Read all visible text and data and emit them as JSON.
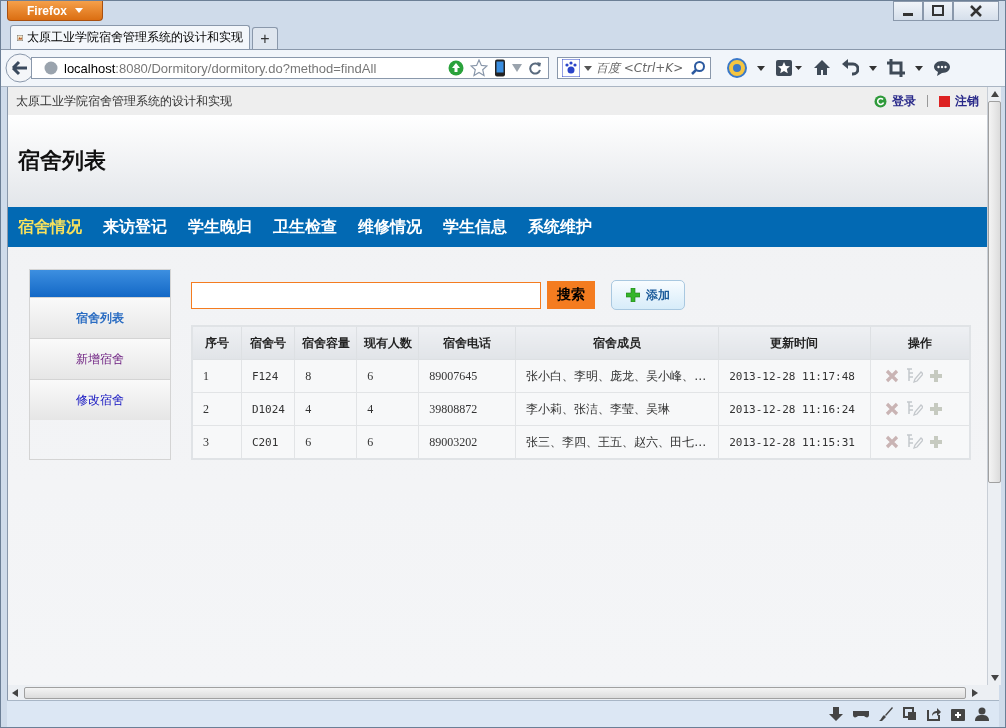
{
  "browser": {
    "menu_button": "Firefox",
    "tab_title": "太原工业学院宿舍管理系统的设计和实现",
    "new_tab": "+",
    "url_host": "localhost",
    "url_rest": ":8080/Dormitory/dormitory.do?method=findAll",
    "search_placeholder": "百度 <Ctrl+K>"
  },
  "page": {
    "site_name": "太原工业学院宿舍管理系统的设计和实现",
    "login": "登录",
    "logout": "注销",
    "heading": "宿舍列表",
    "nav": [
      {
        "label": "宿舍情况",
        "selected": true
      },
      {
        "label": "来访登记",
        "selected": false
      },
      {
        "label": "学生晚归",
        "selected": false
      },
      {
        "label": "卫生检查",
        "selected": false
      },
      {
        "label": "维修情况",
        "selected": false
      },
      {
        "label": "学生信息",
        "selected": false
      },
      {
        "label": "系统维护",
        "selected": false
      }
    ],
    "sidebar": [
      {
        "label": "宿舍列表",
        "selected": true,
        "visited": false
      },
      {
        "label": "新增宿舍",
        "selected": false,
        "visited": true
      },
      {
        "label": "修改宿舍",
        "selected": false,
        "visited": false
      }
    ],
    "search_button": "搜索",
    "add_button": "添加",
    "table": {
      "columns": [
        "序号",
        "宿舍号",
        "宿舍容量",
        "现有人数",
        "宿舍电话",
        "宿舍成员",
        "更新时间",
        "操作"
      ],
      "rows": [
        {
          "cells": [
            "1",
            "F124",
            "8",
            "6",
            "89007645",
            "张小白、李明、庞龙、吴小峰、…",
            "2013-12-28 11:17:48"
          ]
        },
        {
          "cells": [
            "2",
            "D1024",
            "4",
            "4",
            "39808872",
            "李小莉、张洁、李莹、吴琳",
            "2013-12-28 11:16:24"
          ]
        },
        {
          "cells": [
            "3",
            "C201",
            "6",
            "6",
            "89003202",
            "张三、李四、王五、赵六、田七…",
            "2013-12-28 11:15:31"
          ]
        }
      ]
    }
  }
}
